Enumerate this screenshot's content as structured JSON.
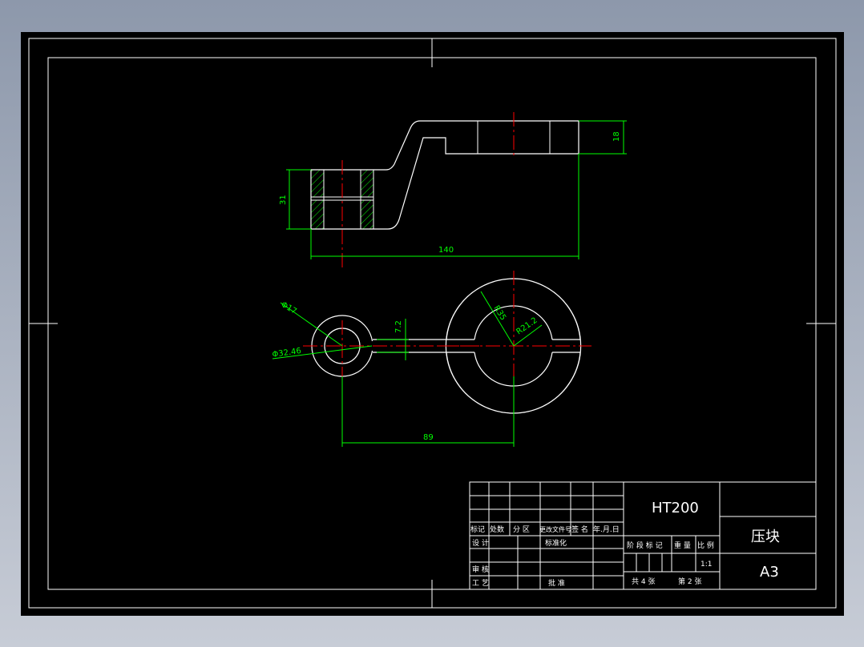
{
  "colors": {
    "background": "#000000",
    "outline": "#ffffff",
    "dimension": "#00ff00",
    "centerline": "#ff0000",
    "hatch": "#00ff00"
  },
  "dimensions": {
    "height_top": "18",
    "height_left": "31",
    "length_total": "140",
    "center_distance": "89",
    "diameter_small": "Φ17",
    "diameter_outer": "Φ32.46",
    "slot_width": "7.2",
    "radius_big": "R35",
    "radius_inner": "R21.2"
  },
  "title_block": {
    "material": "HT200",
    "part_name": "压块",
    "sheet_size": "A3",
    "scale": "1:1",
    "header_marks": "标记",
    "header_count": "处数",
    "header_zone": "分 区",
    "header_doc": "更改文件号",
    "header_sign": "签 名",
    "header_date": "年.月.日",
    "row_design": "设 计",
    "row_standard": "标准化",
    "row_review": "审 核",
    "row_process": "工 艺",
    "row_approve": "批 准",
    "stage_mark": "阶 段 标 记",
    "weight": "重 量",
    "ratio": "比 例",
    "sheets_total": "共  4  张",
    "sheet_no": "第  2  张"
  }
}
